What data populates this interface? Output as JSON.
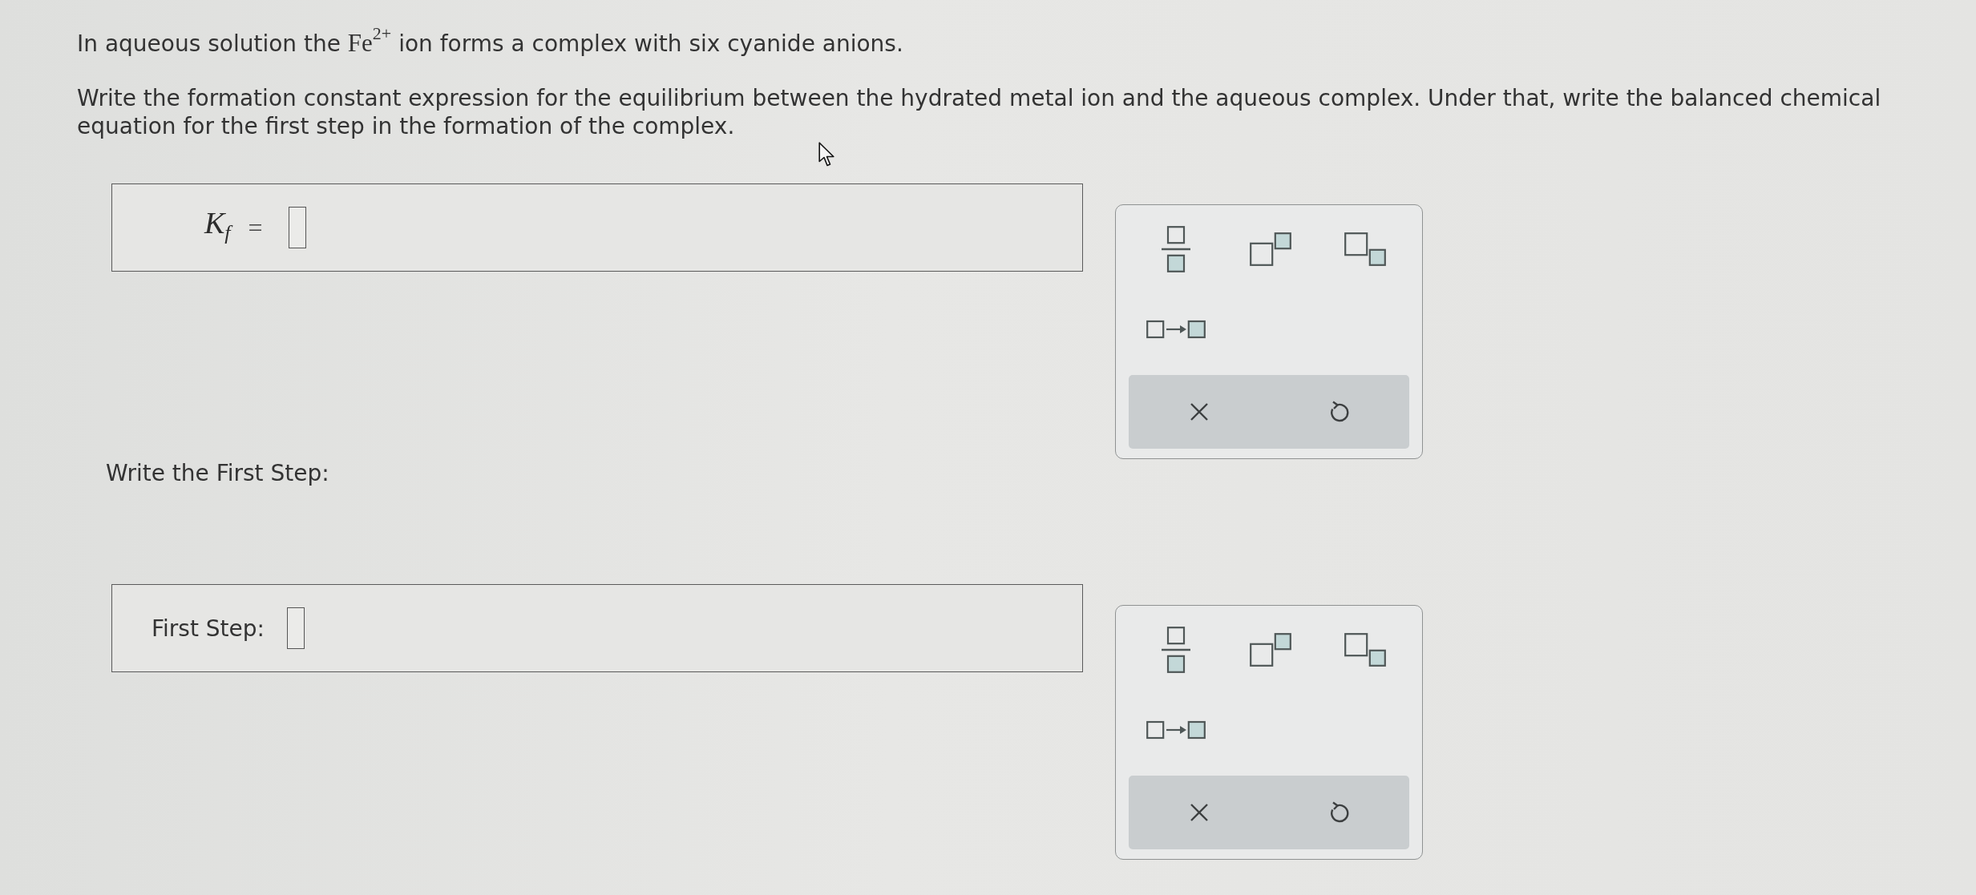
{
  "question": {
    "intro": {
      "before": "In aqueous solution the",
      "formula": "Fe$^{2+}$",
      "after": "ion forms a complex with six cyanide anions."
    },
    "instructions": "Write the formation constant expression for the equilibrium between the hydrated metal ion and the aqueous complex. Under that, write the balanced chemical equation for the first step in the formation of the complex."
  },
  "answers": [
    {
      "kind": "math",
      "label": "K$_{f}$",
      "relation": "=",
      "toolbar": {
        "tools": [
          {
            "kind": "fraction"
          },
          {
            "kind": "superscript"
          },
          {
            "kind": "subscript"
          },
          {
            "kind": "arrow"
          }
        ],
        "actions": [
          {
            "kind": "clear"
          },
          {
            "kind": "undo"
          }
        ]
      }
    },
    {
      "kind": "text",
      "prompt": "Write the First Step:",
      "label": "First Step:",
      "toolbar": {
        "tools": [
          {
            "kind": "fraction"
          },
          {
            "kind": "superscript"
          },
          {
            "kind": "subscript"
          },
          {
            "kind": "arrow"
          }
        ],
        "actions": [
          {
            "kind": "clear"
          },
          {
            "kind": "undo"
          }
        ]
      }
    }
  ]
}
